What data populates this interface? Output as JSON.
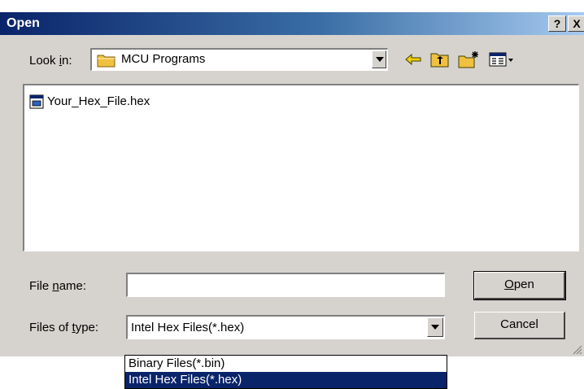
{
  "window": {
    "title": "Open",
    "help_label": "?",
    "close_label": "X"
  },
  "look_in": {
    "label_prefix": "Look ",
    "label_accel": "i",
    "label_suffix": "n:",
    "value": "MCU Programs",
    "folder_icon": "folder-icon"
  },
  "toolbar": {
    "back_icon": "back-arrow-icon",
    "up_icon": "up-folder-icon",
    "new_folder_icon": "new-folder-icon",
    "view_icon": "view-menu-icon"
  },
  "files": [
    {
      "name": "Your_Hex_File.hex",
      "icon": "hex-file-icon"
    }
  ],
  "file_name": {
    "label_prefix": "File ",
    "label_accel": "n",
    "label_suffix": "ame:",
    "value": ""
  },
  "file_type": {
    "label_prefix": "Files of ",
    "label_accel": "t",
    "label_suffix": "ype:",
    "value": "Intel Hex Files(*.hex)",
    "options": [
      {
        "label": "Binary Files(*.bin)",
        "selected": false
      },
      {
        "label": "Intel Hex Files(*.hex)",
        "selected": true
      }
    ]
  },
  "buttons": {
    "open_accel": "O",
    "open_rest": "pen",
    "cancel": "Cancel"
  },
  "colors": {
    "title_bar": "#0a246a",
    "dialog_face": "#d6d3ce",
    "selection": "#0a246a",
    "folder": "#f0c040"
  }
}
